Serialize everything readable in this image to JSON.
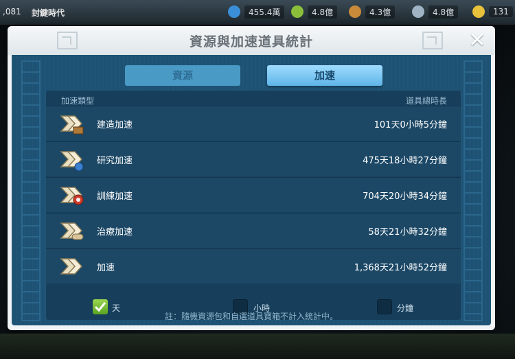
{
  "topbar": {
    "power": ",081",
    "era": "封鍵時代",
    "resources": [
      {
        "icon": "food-icon",
        "value": "455.4萬",
        "color": "#3a8fd8"
      },
      {
        "icon": "wood-icon",
        "value": "4.8億",
        "color": "#8bbf3a"
      },
      {
        "icon": "stone-icon",
        "value": "4.3億",
        "color": "#c98a3a"
      },
      {
        "icon": "gold-icon",
        "value": "4.8億",
        "color": "#9fb3c4"
      },
      {
        "icon": "gem-icon",
        "value": "131",
        "color": "#e8c23a"
      }
    ]
  },
  "modal": {
    "title": "資源與加速道具統計",
    "tabs": {
      "resources": "資源",
      "speedups": "加速"
    },
    "columns": {
      "type": "加速類型",
      "total": "道具總時長"
    },
    "rows": [
      {
        "icon": "building-speedup-icon",
        "name": "建造加速",
        "duration": "101天0小時5分鐘"
      },
      {
        "icon": "research-speedup-icon",
        "name": "研究加速",
        "duration": "475天18小時27分鐘"
      },
      {
        "icon": "training-speedup-icon",
        "name": "訓練加速",
        "duration": "704天20小時34分鐘"
      },
      {
        "icon": "healing-speedup-icon",
        "name": "治療加速",
        "duration": "58天21小時32分鐘"
      },
      {
        "icon": "universal-speedup-icon",
        "name": "加速",
        "duration": "1,368天21小時52分鐘"
      }
    ],
    "units": [
      {
        "label": "天",
        "checked": true
      },
      {
        "label": "小時",
        "checked": false
      },
      {
        "label": "分鐘",
        "checked": false
      }
    ],
    "note": "註：隨機資源包和自選道具寶箱不計入統計中。"
  }
}
